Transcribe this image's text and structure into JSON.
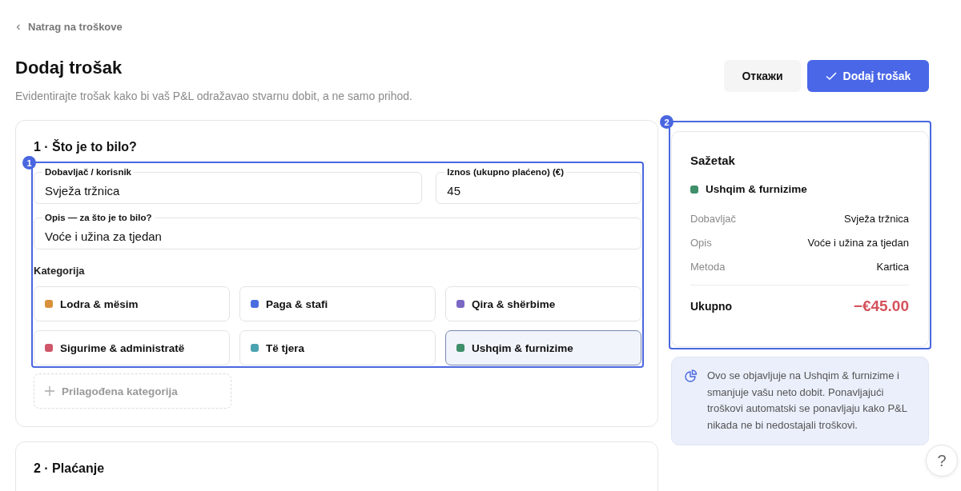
{
  "back_link": {
    "label": "Natrag na troškove"
  },
  "header": {
    "title": "Dodaj trošak",
    "subtitle": "Evidentirajte trošak kako bi vaš P&L odražavao stvarnu dobit, a ne samo prihod.",
    "buttons": [
      {
        "label": "Откажи",
        "kind": "secondary"
      },
      {
        "label": "Dodaj trošak",
        "kind": "primary"
      }
    ]
  },
  "sections": [
    {
      "title": "1 · Što je to bilo?",
      "highlight": "1",
      "fields": [
        {
          "label": "Dobavljač / korisnik",
          "value": "Svježa tržnica"
        },
        {
          "label": "Iznos (ukupno plaćeno) (€)",
          "value": "45"
        },
        {
          "label": "Opis — za što je to bilo?",
          "value": "Voće i užina za tjedan"
        }
      ],
      "category_label": "Kategorija",
      "categories": [
        {
          "label": "Lodra & mësim",
          "color": "#d8913a",
          "selected": false
        },
        {
          "label": "Paga & stafi",
          "color": "#4a6ee0",
          "selected": false
        },
        {
          "label": "Qira & shërbime",
          "color": "#7b68c4",
          "selected": false
        },
        {
          "label": "Sigurime & administratë",
          "color": "#d0566a",
          "selected": false
        },
        {
          "label": "Të tjera",
          "color": "#4aa3b0",
          "selected": false
        },
        {
          "label": "Ushqim & furnizime",
          "color": "#3f8f6a",
          "selected": true
        }
      ],
      "add_category": "Prilagođena kategorija"
    },
    {
      "title": "2 · Plaćanje"
    }
  ],
  "summary": {
    "title": "Sažetak",
    "highlight": "2",
    "category": {
      "label": "Ushqim & furnizime",
      "color": "#3f8f6a"
    },
    "rows": [
      {
        "label": "Dobavljač",
        "value": "Svježa tržnica"
      },
      {
        "label": "Opis",
        "value": "Voće i užina za tjedan"
      },
      {
        "label": "Metoda",
        "value": "Kartica"
      }
    ],
    "total_label": "Ukupno",
    "total_value": "−€45.00"
  },
  "note": {
    "text": "Ovo se objavljuje na Ushqim & furnizime i smanjuje vašu neto dobit. Ponavljajući troškovi automatski se ponavljaju kako P&L nikada ne bi nedostajali troškovi."
  },
  "help": {
    "label": "?"
  }
}
